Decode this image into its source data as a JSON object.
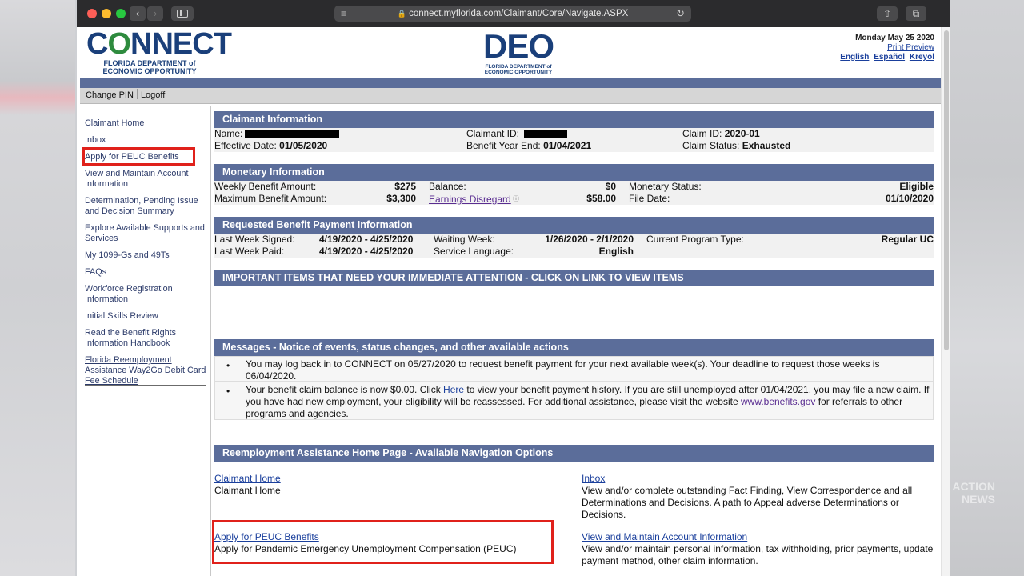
{
  "browser": {
    "url": "connect.myflorida.com/Claimant/Core/Navigate.ASPX"
  },
  "header": {
    "connect_logo": {
      "wordmark": "CONNECT",
      "line1": "FLORIDA DEPARTMENT of",
      "line2": "ECONOMIC OPPORTUNITY"
    },
    "deo_logo": {
      "wordmark": "DEO",
      "line1": "FLORIDA DEPARTMENT of",
      "line2": "ECONOMIC OPPORTUNITY"
    },
    "date": "Monday May 25 2020",
    "print_preview": "Print Preview",
    "languages": [
      "English",
      "Español",
      "Kreyol"
    ]
  },
  "toolbar": {
    "change_pin": "Change PIN",
    "logoff": "Logoff"
  },
  "sidebar": {
    "items": [
      {
        "label": "Claimant Home"
      },
      {
        "label": "Inbox"
      },
      {
        "label": "Apply for PEUC Benefits"
      },
      {
        "label": "View and Maintain Account Information"
      },
      {
        "label": "Determination, Pending Issue and Decision Summary"
      },
      {
        "label": "Explore Available Supports and Services"
      },
      {
        "label": "My 1099-Gs and 49Ts"
      },
      {
        "label": "FAQs"
      },
      {
        "label": "Workforce Registration Information"
      },
      {
        "label": "Initial Skills Review"
      },
      {
        "label": "Read the Benefit Rights Information Handbook"
      },
      {
        "label": "Florida Reemployment Assistance Way2Go Debit Card Fee Schedule"
      }
    ]
  },
  "claimant": {
    "title": "Claimant Information",
    "name_label": "Name:",
    "claimant_id_label": "Claimant ID:",
    "claim_id_label": "Claim ID:",
    "claim_id": "2020-01",
    "effective_label": "Effective Date:",
    "effective": "01/05/2020",
    "benefit_year_label": "Benefit Year End:",
    "benefit_year": "01/04/2021",
    "status_label": "Claim Status:",
    "status": "Exhausted"
  },
  "monetary": {
    "title": "Monetary Information",
    "wba_label": "Weekly Benefit Amount:",
    "wba": "$275",
    "balance_label": "Balance:",
    "balance": "$0",
    "mstatus_label": "Monetary Status:",
    "mstatus": "Eligible",
    "mba_label": "Maximum Benefit Amount:",
    "mba": "$3,300",
    "earnings_label": "Earnings Disregard",
    "earnings": "$58.00",
    "file_label": "File Date:",
    "file_date": "01/10/2020"
  },
  "payment": {
    "title": "Requested Benefit Payment Information",
    "lws_label": "Last Week Signed:",
    "lws": "4/19/2020 - 4/25/2020",
    "ww_label": "Waiting Week:",
    "ww": "1/26/2020 - 2/1/2020",
    "program_label": "Current Program Type:",
    "program": "Regular UC",
    "lwp_label": "Last Week Paid:",
    "lwp": "4/19/2020 - 4/25/2020",
    "lang_label": "Service Language:",
    "lang": "English"
  },
  "important": {
    "title": "IMPORTANT ITEMS THAT NEED YOUR IMMEDIATE ATTENTION - CLICK ON LINK TO VIEW ITEMS"
  },
  "messages": {
    "title": "Messages - Notice of events, status changes, and other available actions",
    "m1": "You may log back in to CONNECT on 05/27/2020 to request benefit payment for your next available week(s). Your deadline to request those weeks is 06/04/2020.",
    "m2_a": "Your benefit claim balance is now $0.00. Click ",
    "m2_link": "Here",
    "m2_b": " to view your benefit payment history. If you are still unemployed after 01/04/2021, you may file a new claim. If you have had new employment, your eligibility will be reassessed. For additional assistance, please visit the website ",
    "m2_link2": "www.benefits.gov",
    "m2_c": " for referrals to other programs and agencies."
  },
  "nav_options": {
    "title": "Reemployment Assistance Home Page - Available Navigation Options",
    "home_title": "Claimant Home",
    "home_desc": "Claimant Home",
    "inbox_title": "Inbox",
    "inbox_desc": "View and/or complete outstanding Fact Finding, View Correspondence and all Determinations and Decisions. A path to Appeal adverse Determinations or Decisions.",
    "peuc_title": "Apply for PEUC Benefits",
    "peuc_desc": "Apply for Pandemic Emergency Unemployment Compensation (PEUC)",
    "account_title": "View and Maintain Account Information",
    "account_desc": "View and/or maintain personal information, tax withholding, prior payments, update payment method, other claim information."
  },
  "watermark": {
    "line1": "ACTION",
    "line2": "NEWS"
  }
}
